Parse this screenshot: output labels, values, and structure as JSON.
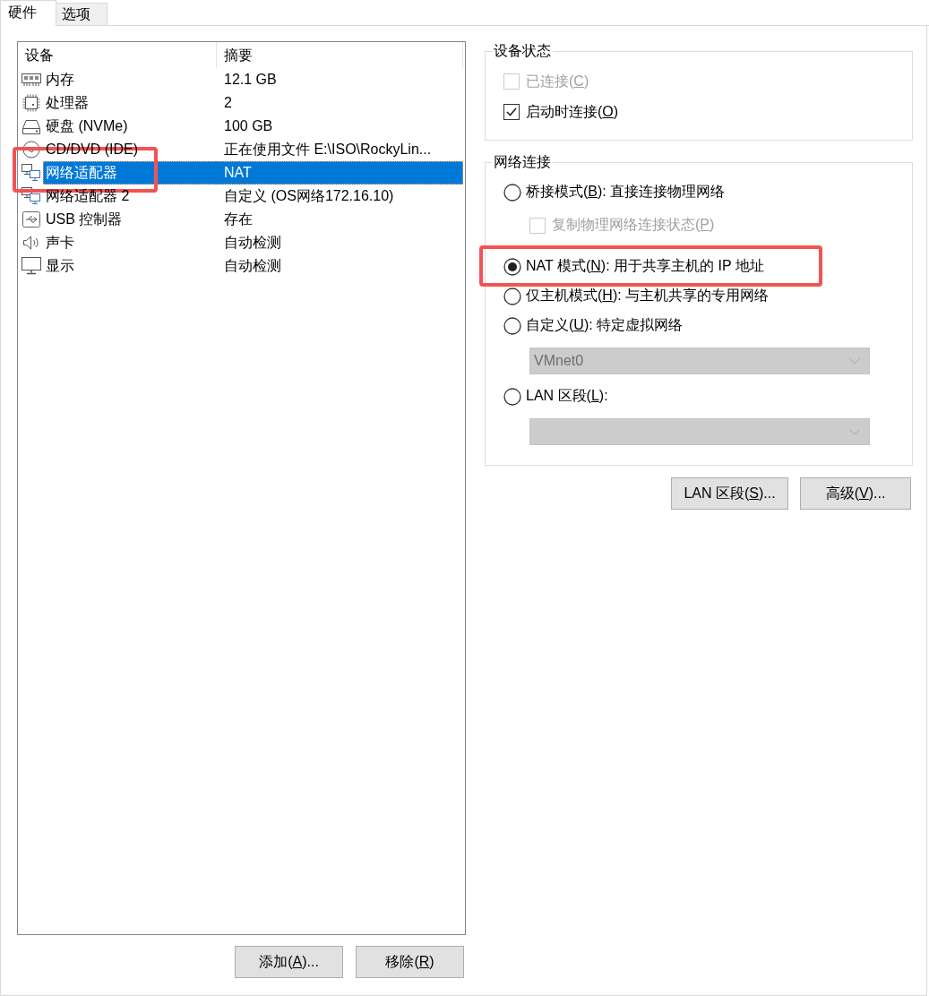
{
  "tabs": [
    {
      "label": "硬件",
      "selected": true
    },
    {
      "label": "选项",
      "selected": false
    }
  ],
  "device_list": {
    "columns": [
      "设备",
      "摘要"
    ],
    "rows": [
      {
        "kind": "memory",
        "name": "内存",
        "summary": "12.1 GB",
        "selected": false,
        "highlighted": false
      },
      {
        "kind": "processor",
        "name": "处理器",
        "summary": "2",
        "selected": false,
        "highlighted": false
      },
      {
        "kind": "disk",
        "name": "硬盘 (NVMe)",
        "summary": "100 GB",
        "selected": false,
        "highlighted": false
      },
      {
        "kind": "cdrom",
        "name": "CD/DVD (IDE)",
        "summary": "正在使用文件 E:\\ISO\\RockyLin...",
        "selected": false,
        "highlighted": false
      },
      {
        "kind": "network",
        "name": "网络适配器",
        "summary": "NAT",
        "selected": true,
        "highlighted": true
      },
      {
        "kind": "network",
        "name": "网络适配器 2",
        "summary": "自定义 (OS网络172.16.10)",
        "selected": false,
        "highlighted": false
      },
      {
        "kind": "usb",
        "name": "USB 控制器",
        "summary": "存在",
        "selected": false,
        "highlighted": false
      },
      {
        "kind": "sound",
        "name": "声卡",
        "summary": "自动检测",
        "selected": false,
        "highlighted": false
      },
      {
        "kind": "display",
        "name": "显示",
        "summary": "自动检测",
        "selected": false,
        "highlighted": false
      }
    ]
  },
  "list_buttons": [
    {
      "before": "添加(",
      "key": "A",
      "after": ")..."
    },
    {
      "before": "移除(",
      "key": "R",
      "after": ")"
    }
  ],
  "device_status": {
    "title": "设备状态",
    "options": [
      {
        "before": "已连接(",
        "key": "C",
        "after": ")",
        "checked": false,
        "disabled": true
      },
      {
        "before": "启动时连接(",
        "key": "O",
        "after": ")",
        "checked": true,
        "disabled": false
      }
    ]
  },
  "network_connection": {
    "title": "网络连接",
    "options": [
      {
        "kind": "radio",
        "before": "桥接模式(",
        "key": "B",
        "after": "): 直接连接物理网络",
        "selected": false,
        "disabled": false,
        "highlighted": false
      },
      {
        "kind": "checkbox",
        "before": "复制物理网络连接状态(",
        "key": "P",
        "after": ")",
        "checked": false,
        "disabled": true,
        "highlighted": false
      },
      {
        "kind": "radio",
        "before": "NAT 模式(",
        "key": "N",
        "after": "): 用于共享主机的 IP 地址",
        "selected": true,
        "disabled": false,
        "highlighted": true
      },
      {
        "kind": "radio",
        "before": "仅主机模式(",
        "key": "H",
        "after": "): 与主机共享的专用网络",
        "selected": false,
        "disabled": false,
        "highlighted": false
      },
      {
        "kind": "radio",
        "before": "自定义(",
        "key": "U",
        "after": "): 特定虚拟网络",
        "selected": false,
        "disabled": false,
        "highlighted": false
      },
      {
        "kind": "dropdown",
        "value": "VMnet0",
        "disabled": true,
        "highlighted": false
      },
      {
        "kind": "radio",
        "before": "LAN 区段(",
        "key": "L",
        "after": "):",
        "selected": false,
        "disabled": false,
        "highlighted": false
      },
      {
        "kind": "dropdown",
        "disabled": true,
        "highlighted": false
      }
    ]
  },
  "network_buttons": [
    {
      "before": "LAN 区段(",
      "key": "S",
      "after": ")..."
    },
    {
      "before": "高级(",
      "key": "V",
      "after": ")..."
    }
  ]
}
